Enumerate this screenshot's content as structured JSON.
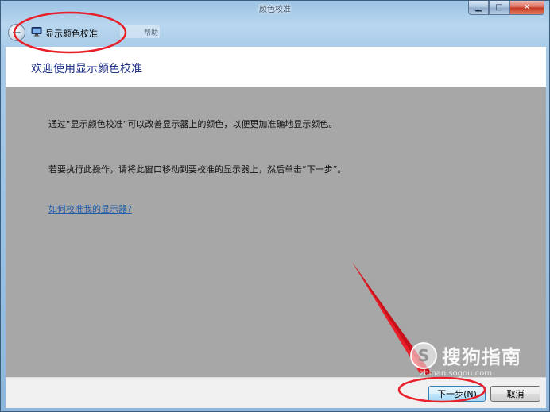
{
  "window": {
    "caption": "颜色校准",
    "app_title": "显示颜色校准",
    "ghost_tab": "帮助"
  },
  "header": {
    "title": "欢迎使用显示颜色校准"
  },
  "content": {
    "paragraph1": "通过“显示颜色校准”可以改善显示器上的颜色，以便更加准确地显示颜色。",
    "paragraph2": "若要执行此操作，请将此窗口移动到要校准的显示器上，然后单击“下一步”。",
    "help_link": "如何校准我的显示器?"
  },
  "footer": {
    "next_label": "下一步(N)",
    "cancel_label": "取消"
  },
  "watermark": {
    "logo_letter": "S",
    "brand": "搜狗指南",
    "url": "zhinan.sogou.com"
  },
  "colors": {
    "annotation_red": "#e8202a",
    "header_text": "#1e3287",
    "link": "#1f5ba8",
    "content_bg": "#a7a7a7"
  }
}
